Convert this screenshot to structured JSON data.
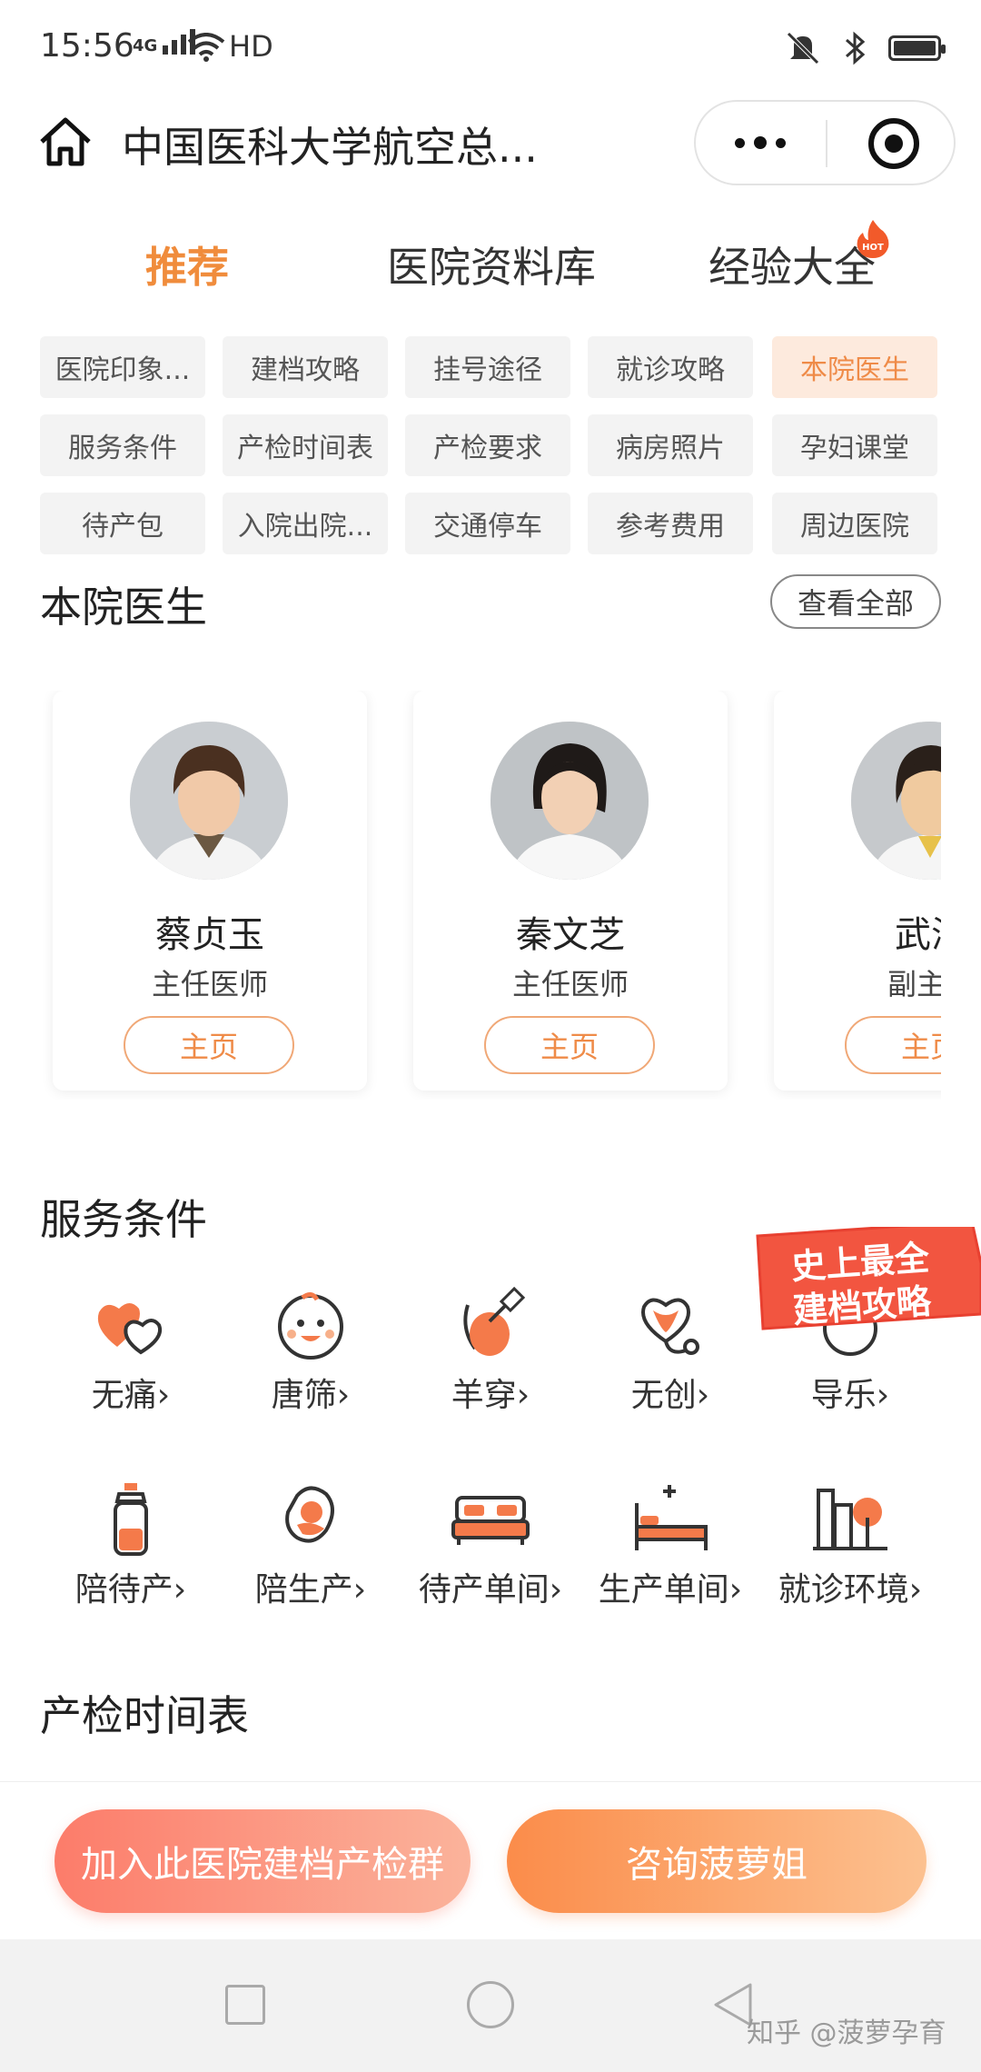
{
  "status_bar": {
    "time": "15:56",
    "network": "4G",
    "hd": "HD"
  },
  "header": {
    "title": "中国医科大学航空总..."
  },
  "tabs": [
    {
      "label": "推荐",
      "active": true
    },
    {
      "label": "医院资料库"
    },
    {
      "label": "经验大全",
      "badge": "HOT"
    }
  ],
  "tags": [
    [
      "医院印象...",
      "建档攻略",
      "挂号途径",
      "就诊攻略",
      "本院医生"
    ],
    [
      "服务条件",
      "产检时间表",
      "产检要求",
      "病房照片",
      "孕妇课堂"
    ],
    [
      "待产包",
      "入院出院...",
      "交通停车",
      "参考费用",
      "周边医院"
    ]
  ],
  "doctors_section": {
    "title": "本院医生",
    "view_all": "查看全部"
  },
  "doctors": [
    {
      "name": "蔡贞玉",
      "title": "主任医师",
      "button": "主页"
    },
    {
      "name": "秦文芝",
      "title": "主任医师",
      "button": "主页"
    },
    {
      "name": "武海",
      "title": "副主任",
      "button": "主页"
    }
  ],
  "services_section": {
    "title": "服务条件"
  },
  "services": [
    {
      "label": "无痛",
      "icon": "hearts-icon"
    },
    {
      "label": "唐筛",
      "icon": "baby-face-icon"
    },
    {
      "label": "羊穿",
      "icon": "syringe-icon"
    },
    {
      "label": "无创",
      "icon": "heart-stethoscope-icon"
    },
    {
      "label": "导乐",
      "icon": "doula-icon"
    },
    {
      "label": "陪待产",
      "icon": "bottle-icon"
    },
    {
      "label": "陪生产",
      "icon": "mother-baby-icon"
    },
    {
      "label": "待产单间",
      "icon": "double-bed-icon"
    },
    {
      "label": "生产单间",
      "icon": "hospital-bed-icon"
    },
    {
      "label": "就诊环境",
      "icon": "building-tree-icon"
    }
  ],
  "promo": {
    "line1": "史上最全",
    "line2": "建档攻略"
  },
  "schedule_section": {
    "title": "产检时间表"
  },
  "actions": {
    "join_group": "加入此医院建档产检群",
    "consult": "咨询菠萝姐"
  },
  "watermark": "知乎 @菠萝孕育",
  "colors": {
    "accent": "#f08c3c",
    "accent_light": "#fdeadd"
  }
}
